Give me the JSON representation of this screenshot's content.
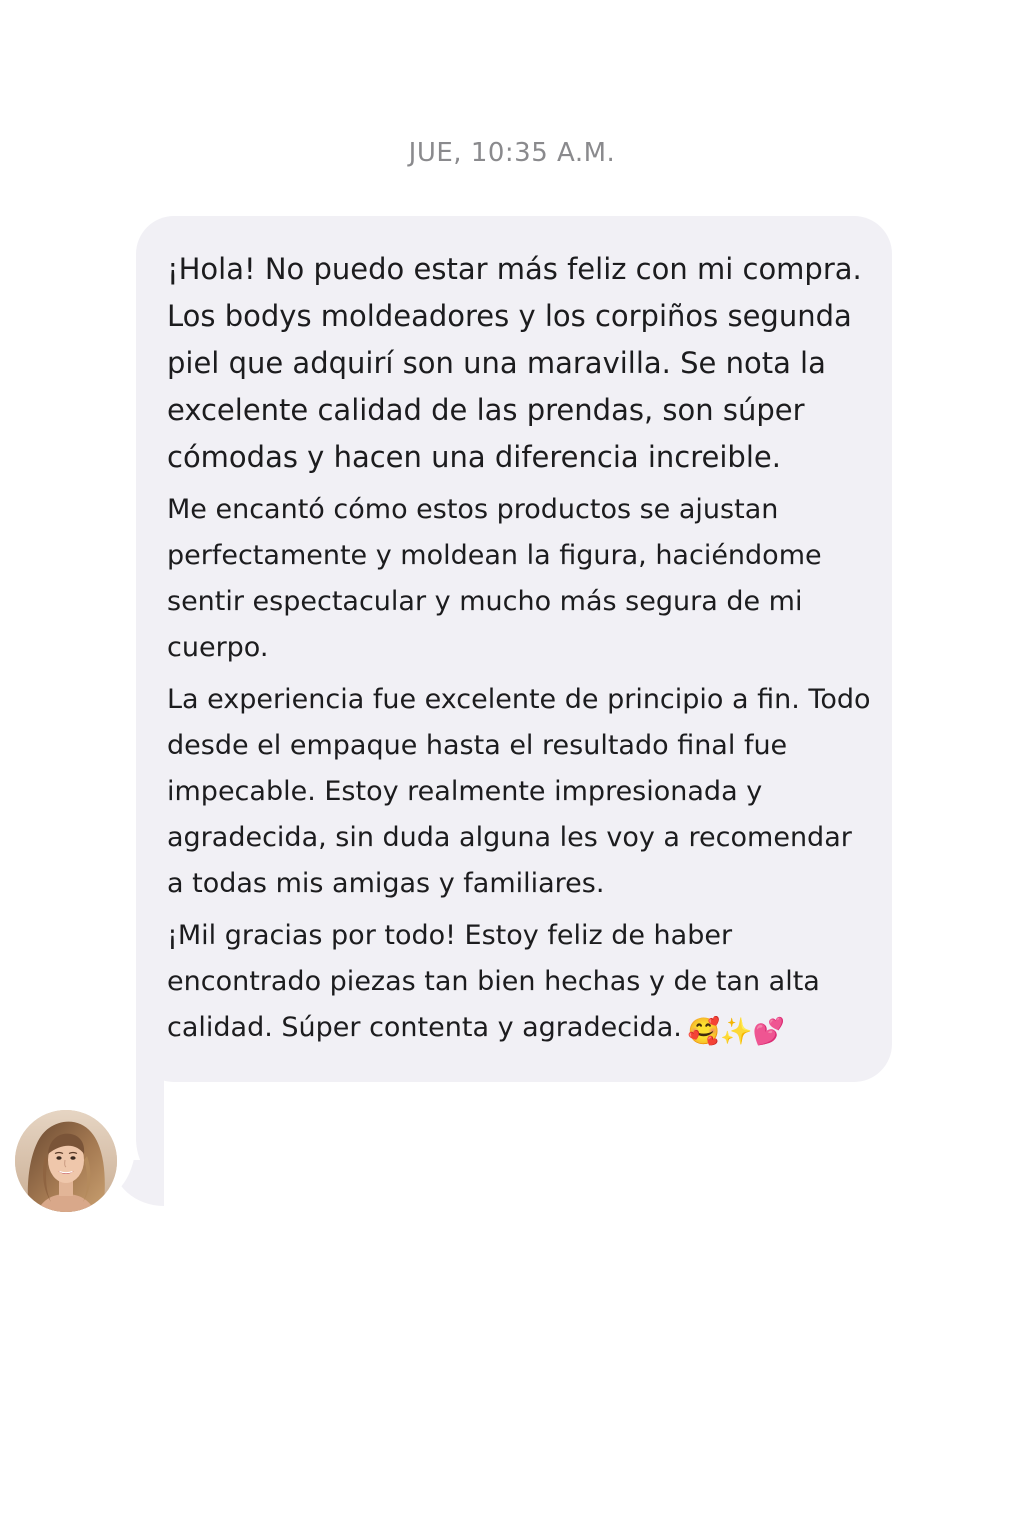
{
  "timestamp": "JUE, 10:35 A.M.",
  "message": {
    "paragraphs": [
      "¡Hola! No puedo estar más feliz con mi compra. Los bodys moldeadores y los corpiños segunda piel que adquirí son una maravilla. Se nota la excelente calidad de las prendas, son súper cómodas y hacen una diferencia increible.",
      "Me encantó cómo estos productos se ajustan perfectamente y moldean la figura, haciéndome sentir espectacular y mucho más segura de mi cuerpo.",
      "La experiencia fue excelente de principio a fin. Todo desde el empaque hasta el resultado final fue impecable. Estoy realmente impresionada y agradecida, sin duda alguna les voy a recomendar a todas mis amigas y familiares.",
      "¡Mil gracias por todo! Estoy feliz de haber encontrado piezas tan bien hechas y de tan alta calidad. Súper contenta y agradecida."
    ],
    "emojis": {
      "face": "🥰",
      "sparkle": "✨",
      "heart": "💕"
    },
    "bubble_color": "#f1f0f5",
    "text_color": "#1c1c1e"
  },
  "sender": {
    "avatar_icon": "profile-photo-woman"
  },
  "colors": {
    "timestamp": "#8a8a8d",
    "background": "#ffffff"
  }
}
